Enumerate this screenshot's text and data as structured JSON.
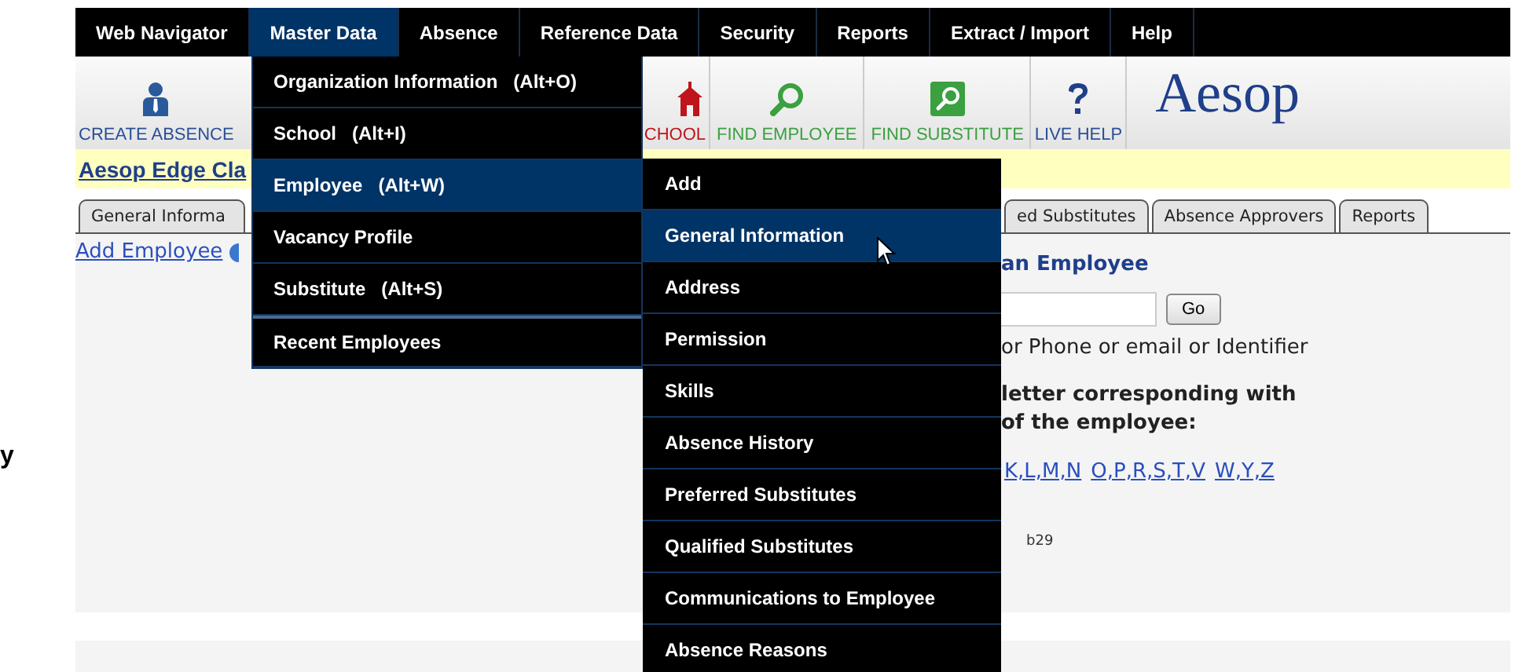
{
  "stray_text": "y",
  "menu_bar": [
    {
      "label": "Web Navigator",
      "selected": false
    },
    {
      "label": "Master Data",
      "selected": true
    },
    {
      "label": "Absence",
      "selected": false
    },
    {
      "label": "Reference Data",
      "selected": false
    },
    {
      "label": "Security",
      "selected": false
    },
    {
      "label": "Reports",
      "selected": false
    },
    {
      "label": "Extract / Import",
      "selected": false
    },
    {
      "label": "Help",
      "selected": false
    }
  ],
  "toolbar": {
    "left": [
      {
        "kind": "person",
        "label": "CREATE ABSENCE"
      }
    ],
    "right": [
      {
        "kind": "school",
        "label": "CHOOL"
      },
      {
        "kind": "magnifier",
        "label": "FIND EMPLOYEE"
      },
      {
        "kind": "magnifier_box",
        "label": "FIND SUBSTITUTE"
      },
      {
        "kind": "help",
        "label": "LIVE HELP"
      }
    ],
    "logo": "Aesop"
  },
  "banner": {
    "link": "Aesop Edge Cla"
  },
  "tabs_left": [
    {
      "label": "General Informa",
      "selected": false
    }
  ],
  "tabs_right": [
    {
      "label": "ed Substitutes",
      "selected": false
    },
    {
      "label": "Absence Approvers",
      "selected": false
    },
    {
      "label": "Reports",
      "selected": false
    }
  ],
  "content": {
    "add_link": "Add Employee",
    "heading": "an Employee",
    "search": {
      "button": "Go"
    },
    "hint": "or Phone or email or Identifier",
    "instruction": [
      "letter corresponding with",
      "of the employee:"
    ],
    "letter_links": [
      "K,L,M,N",
      "O,P,R,S,T,V",
      "W,Y,Z"
    ],
    "footer_code": "b29"
  },
  "dropdown": [
    {
      "label": "Organization Information   (Alt+O)",
      "selected": false,
      "separator_above": false
    },
    {
      "label": "School   (Alt+I)",
      "selected": false,
      "separator_above": false
    },
    {
      "label": "Employee   (Alt+W)",
      "selected": true,
      "separator_above": false
    },
    {
      "label": "Vacancy Profile",
      "selected": false,
      "separator_above": false
    },
    {
      "label": "Substitute   (Alt+S)",
      "selected": false,
      "separator_above": false
    },
    {
      "label": "Recent Employees",
      "selected": false,
      "separator_above": true
    }
  ],
  "submenu": [
    {
      "label": "Add",
      "selected": false
    },
    {
      "label": "General Information",
      "selected": true
    },
    {
      "label": "Address",
      "selected": false
    },
    {
      "label": "Permission",
      "selected": false
    },
    {
      "label": "Skills",
      "selected": false
    },
    {
      "label": "Absence History",
      "selected": false
    },
    {
      "label": "Preferred Substitutes",
      "selected": false
    },
    {
      "label": "Qualified Substitutes",
      "selected": false
    },
    {
      "label": "Communications to Employee",
      "selected": false
    },
    {
      "label": "Absence Reasons",
      "selected": false
    }
  ]
}
